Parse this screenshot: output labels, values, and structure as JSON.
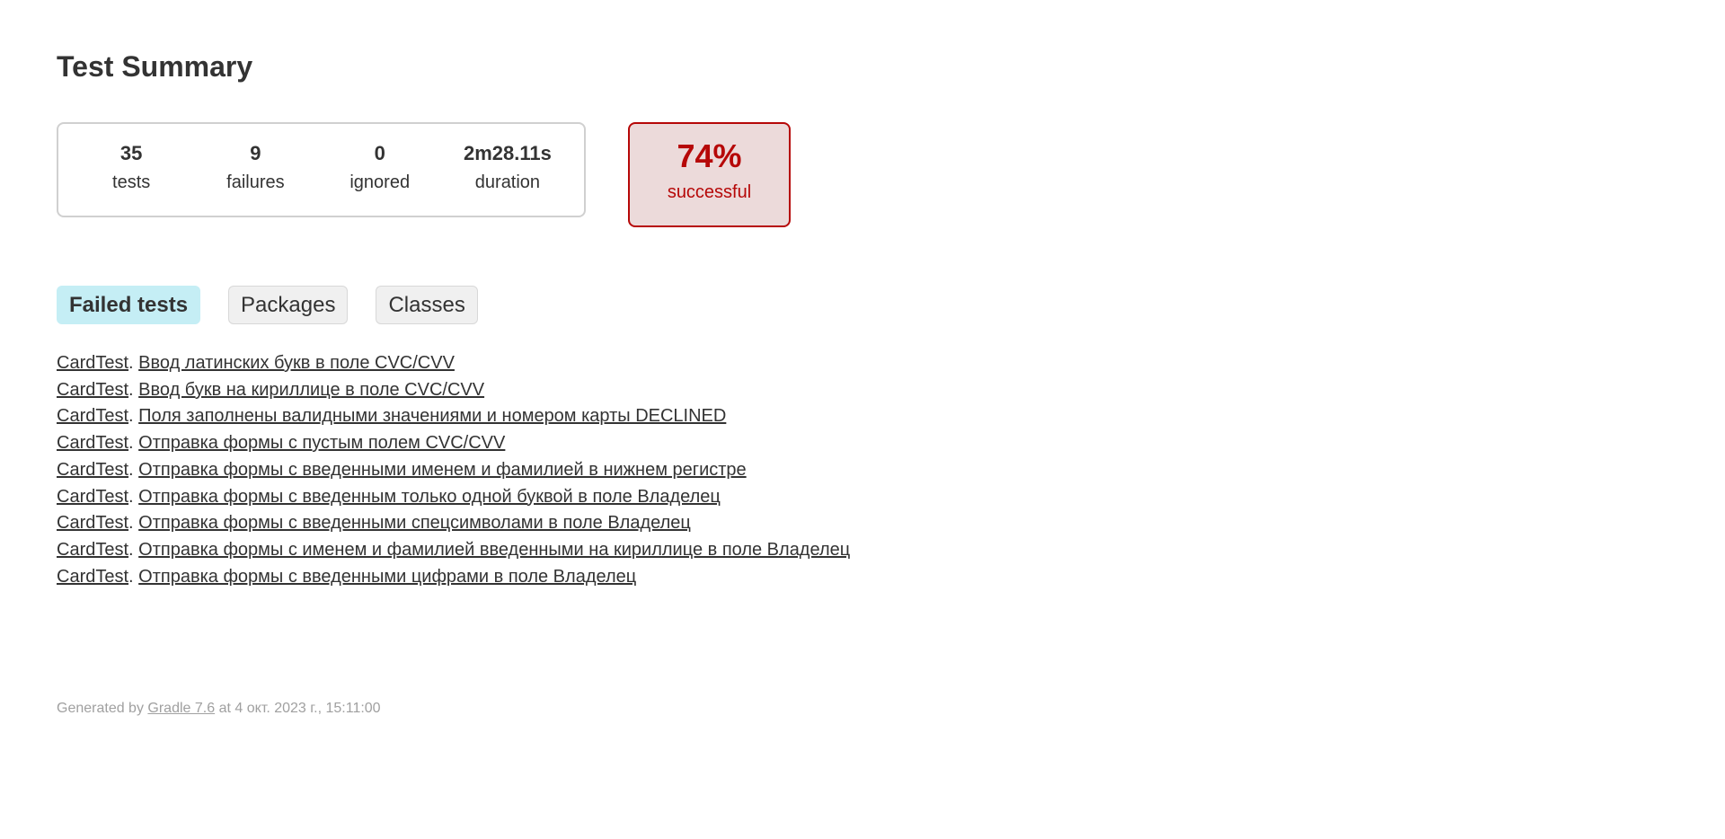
{
  "page": {
    "title": "Test Summary"
  },
  "summary": {
    "counters": [
      {
        "value": "35",
        "label": "tests"
      },
      {
        "value": "9",
        "label": "failures"
      },
      {
        "value": "0",
        "label": "ignored"
      },
      {
        "value": "2m28.11s",
        "label": "duration"
      }
    ],
    "success_rate": "74%",
    "success_label": "successful",
    "status_color": "#b60808",
    "status_bg": "#ecdada"
  },
  "tabs": [
    {
      "label": "Failed tests",
      "selected": true
    },
    {
      "label": "Packages",
      "selected": false
    },
    {
      "label": "Classes",
      "selected": false
    }
  ],
  "failed_tests": [
    {
      "class": "CardTest",
      "test": "Ввод латинских букв в поле CVC/CVV"
    },
    {
      "class": "CardTest",
      "test": "Ввод букв на кириллице в поле CVC/CVV"
    },
    {
      "class": "CardTest",
      "test": "Поля заполнены валидными значениями и номером карты DECLINED"
    },
    {
      "class": "CardTest",
      "test": "Отправка формы с пустым полем CVC/CVV"
    },
    {
      "class": "CardTest",
      "test": "Отправка формы с введенными именем и фамилией в нижнем регистре"
    },
    {
      "class": "CardTest",
      "test": "Отправка формы с введенным только одной буквой в поле Владелец"
    },
    {
      "class": "CardTest",
      "test": "Отправка формы с введенными спецсимволами в поле Владелец"
    },
    {
      "class": "CardTest",
      "test": "Отправка формы с именем и фамилией введенными на кириллице в поле Владелец"
    },
    {
      "class": "CardTest",
      "test": "Отправка формы с введенными цифрами в поле Владелец"
    }
  ],
  "footer": {
    "prefix": "Generated by ",
    "link": "Gradle 7.6",
    "suffix": " at 4 окт. 2023 г., 15:11:00"
  }
}
